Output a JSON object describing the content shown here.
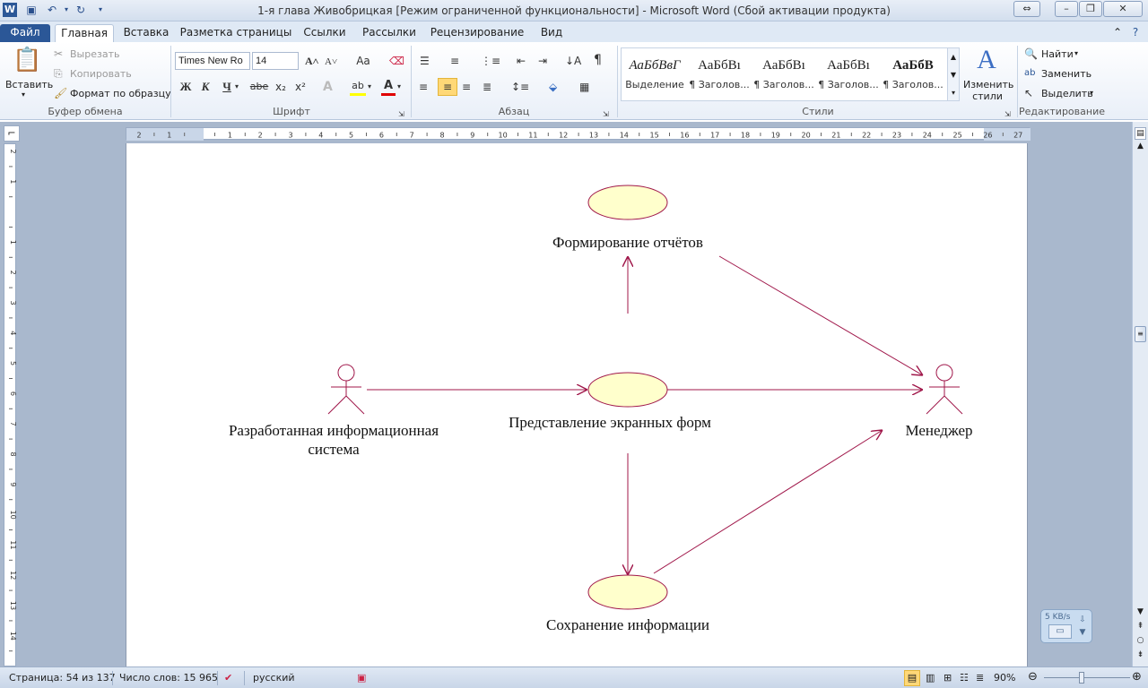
{
  "window": {
    "title": "1-я глава Живобрицкая [Режим ограниченной функциональности]  -  Microsoft Word (Сбой активации продукта)",
    "app_icon": "W"
  },
  "tabs": [
    "Файл",
    "Главная",
    "Вставка",
    "Разметка страницы",
    "Ссылки",
    "Рассылки",
    "Рецензирование",
    "Вид"
  ],
  "ribbon": {
    "clipboard": {
      "paste": "Вставить",
      "cut": "Вырезать",
      "copy": "Копировать",
      "format_painter": "Формат по образцу",
      "label": "Буфер обмена"
    },
    "font": {
      "name": "Times New Ro",
      "size": "14",
      "label": "Шрифт",
      "aa": "Aa",
      "bold": "Ж",
      "italic": "К",
      "underline": "Ч",
      "strike": "abe",
      "sub": "x₂",
      "sup": "x²",
      "highlight": "ab",
      "color": "A"
    },
    "paragraph": {
      "label": "Абзац"
    },
    "styles": {
      "label": "Стили",
      "items": [
        {
          "sample": "АаБбВвГ",
          "name": "Выделение"
        },
        {
          "sample": "АаБбВı",
          "name": "¶ Заголов..."
        },
        {
          "sample": "АаБбВı",
          "name": "¶ Заголов..."
        },
        {
          "sample": "АаБбВı",
          "name": "¶ Заголов..."
        },
        {
          "sample": "АаБбВ",
          "name": "¶ Заголов..."
        }
      ],
      "change": "Изменить стили"
    },
    "editing": {
      "find": "Найти",
      "replace": "Заменить",
      "select": "Выделить",
      "label": "Редактирование"
    }
  },
  "ruler": {
    "h_ticks": [
      "2",
      "1",
      "",
      "1",
      "2",
      "3",
      "4",
      "5",
      "6",
      "7",
      "8",
      "9",
      "10",
      "11",
      "12",
      "13",
      "14",
      "15",
      "16",
      "17",
      "18",
      "19",
      "20",
      "21",
      "22",
      "23",
      "24",
      "25",
      "26",
      "27"
    ],
    "v_ticks": [
      "2",
      "1",
      "",
      "1",
      "2",
      "3",
      "4",
      "5",
      "6",
      "7",
      "8",
      "9",
      "10",
      "11",
      "12",
      "13",
      "14"
    ]
  },
  "diagram": {
    "use_cases": [
      {
        "id": "uc-reports",
        "label": "Формирование отчётов"
      },
      {
        "id": "uc-screen-forms",
        "label": "Представление экранных форм"
      },
      {
        "id": "uc-save",
        "label": "Сохранение информации"
      }
    ],
    "actors": [
      {
        "id": "actor-system",
        "label": "Разработанная информационная система"
      },
      {
        "id": "actor-manager",
        "label": "Менеджер"
      }
    ],
    "colors": {
      "use_case_fill": "#ffffcc",
      "line": "#a0174a"
    }
  },
  "status": {
    "page": "Страница: 54 из 137",
    "words": "Число слов: 15 965",
    "language": "русский",
    "zoom": "90%"
  },
  "net_widget": {
    "speed": "5 KB/s"
  }
}
